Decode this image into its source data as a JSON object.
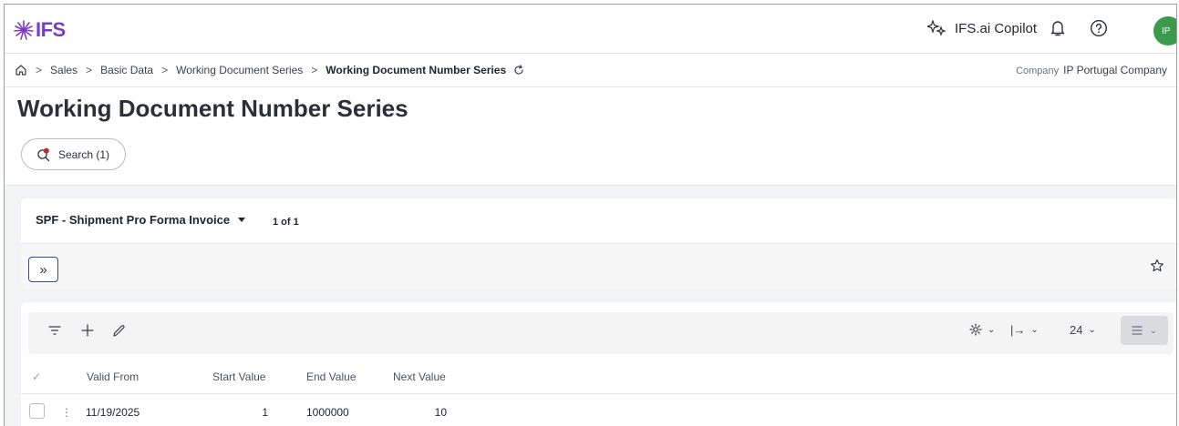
{
  "header": {
    "logo_text": "IFS",
    "copilot_label": "IFS.ai Copilot",
    "avatar_initials": "IP"
  },
  "breadcrumb": {
    "items": [
      "Sales",
      "Basic Data",
      "Working Document Series"
    ],
    "current": "Working Document Number Series"
  },
  "company": {
    "label": "Company",
    "value": "IP Portugal Company"
  },
  "page": {
    "title": "Working Document Number Series",
    "search_label": "Search (1)"
  },
  "record": {
    "selected": "SPF - Shipment Pro Forma Invoice",
    "count": "1 of 1"
  },
  "grid": {
    "page_size": "24",
    "columns": [
      "Valid From",
      "Start Value",
      "End Value",
      "Next Value"
    ],
    "rows": [
      {
        "valid_from": "11/19/2025",
        "start_value": "1",
        "end_value": "1000000",
        "next_value": "10"
      }
    ]
  },
  "colors": {
    "brand": "#7d3cc7",
    "avatar": "#3b9a4c",
    "expand_border": "#3a4a8a"
  }
}
